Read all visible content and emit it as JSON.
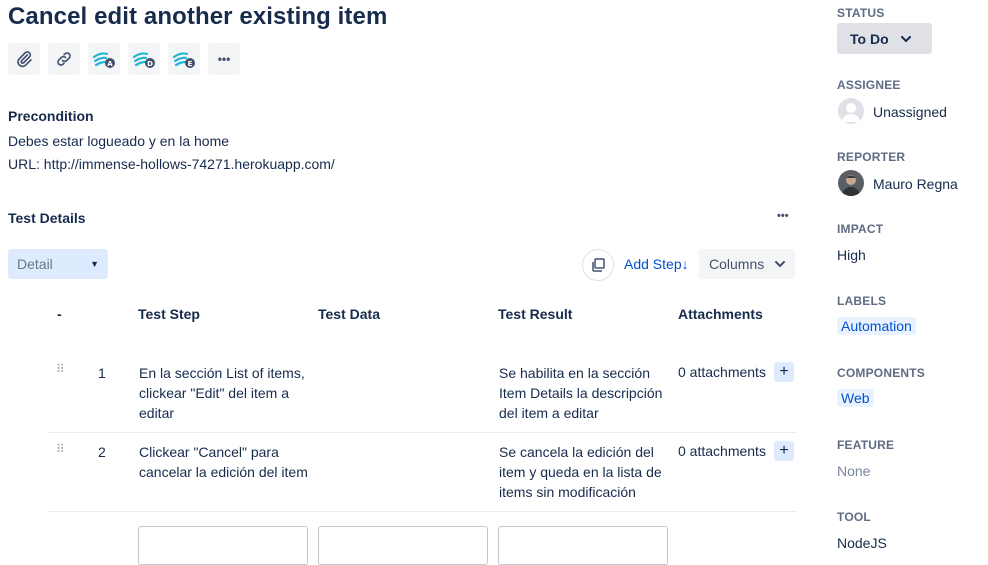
{
  "issue": {
    "title": "Cancel edit another existing item"
  },
  "toolbar": {
    "icons": [
      "attachment-icon",
      "link-icon",
      "xray-a-icon",
      "xray-d-icon",
      "xray-e-icon",
      "more-icon"
    ],
    "more_label": "•••"
  },
  "precondition": {
    "heading": "Precondition",
    "line1": "Debes estar logueado y en la home",
    "line2": "URL: http://immense-hollows-74271.herokuapp.com/"
  },
  "test_details": {
    "heading": "Test Details",
    "more_label": "•••",
    "view_select": "Detail",
    "add_step_label": "Add Step↓",
    "columns_label": "Columns",
    "columns": [
      "-",
      "Test Step",
      "Test Data",
      "Test Result",
      "Attachments"
    ],
    "rows": [
      {
        "index": "1",
        "step": "En la sección List of items, clickear \"Edit\" del item a editar",
        "data": "",
        "result": "Se habilita en la sección Item Details la descripción del item a editar",
        "attachments": "0 attachments"
      },
      {
        "index": "2",
        "step": "Clickear \"Cancel\" para cancelar la edición del item",
        "data": "",
        "result": "Se cancela la edición del item y queda en la lista de items sin modificación",
        "attachments": "0 attachments"
      }
    ],
    "plus_label": "+"
  },
  "sidebar": {
    "status_label": "STATUS",
    "status_value": "To Do",
    "assignee_label": "ASSIGNEE",
    "assignee_value": "Unassigned",
    "reporter_label": "REPORTER",
    "reporter_value": "Mauro Regna",
    "impact_label": "IMPACT",
    "impact_value": "High",
    "labels_label": "LABELS",
    "labels_value": "Automation",
    "components_label": "COMPONENTS",
    "components_value": "Web",
    "feature_label": "FEATURE",
    "feature_value": "None",
    "tool_label": "TOOL",
    "tool_value": "NodeJS"
  },
  "colors": {
    "primary_text": "#172b4d",
    "link": "#0052cc",
    "muted": "#5e6c84",
    "xray_teal": "#1fb6d4"
  }
}
